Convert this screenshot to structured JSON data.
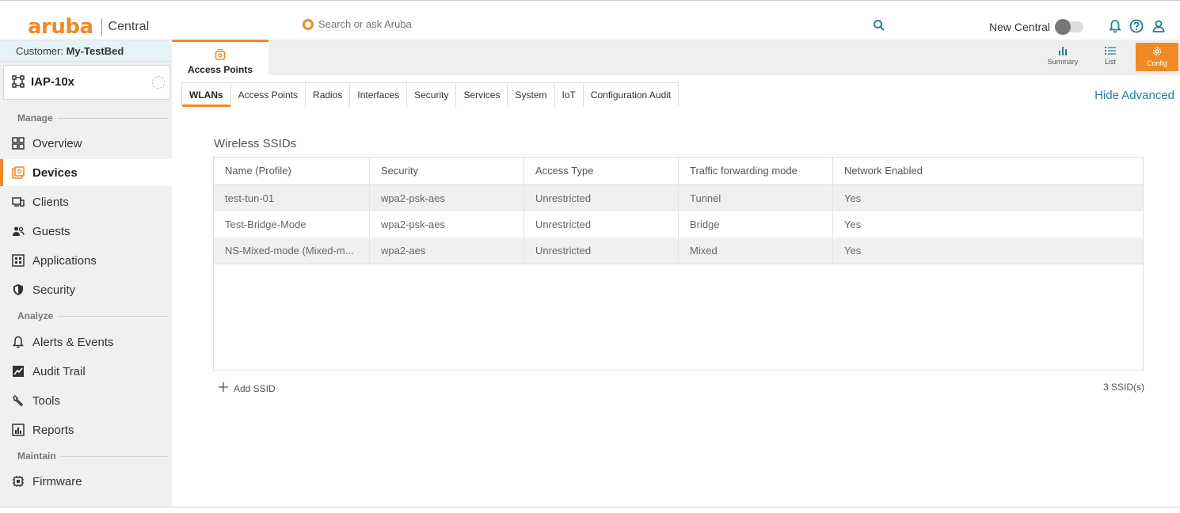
{
  "app": {
    "logo_text": "aruba",
    "product_name": "Central",
    "brand_color": "#f08a24",
    "link_color": "#1f7f93"
  },
  "topbar": {
    "search_placeholder": "Search or ask Aruba",
    "new_central_label": "New Central",
    "new_central_enabled": false,
    "icons": [
      "search-icon",
      "bell-icon",
      "help-icon",
      "user-icon"
    ]
  },
  "sidebar": {
    "customer_prefix": "Customer:",
    "customer_name": "My-TestBed",
    "group_name": "IAP-10x",
    "sections": {
      "manage": "Manage",
      "analyze": "Analyze",
      "maintain": "Maintain"
    },
    "items": [
      {
        "label": "Overview",
        "icon": "grid-icon"
      },
      {
        "label": "Devices",
        "icon": "devices-icon",
        "active": true
      },
      {
        "label": "Clients",
        "icon": "clients-icon"
      },
      {
        "label": "Guests",
        "icon": "guests-icon"
      },
      {
        "label": "Applications",
        "icon": "applications-icon"
      },
      {
        "label": "Security",
        "icon": "shield-icon"
      },
      {
        "label": "Alerts & Events",
        "icon": "bell-icon"
      },
      {
        "label": "Audit Trail",
        "icon": "audit-icon"
      },
      {
        "label": "Tools",
        "icon": "wrench-icon"
      },
      {
        "label": "Reports",
        "icon": "reports-icon"
      },
      {
        "label": "Firmware",
        "icon": "firmware-icon"
      }
    ]
  },
  "header": {
    "device_tab_label": "Access Points",
    "views": {
      "summary": "Summary",
      "list": "List",
      "config": "Config"
    }
  },
  "tabs": [
    "WLANs",
    "Access Points",
    "Radios",
    "Interfaces",
    "Security",
    "Services",
    "System",
    "IoT",
    "Configuration Audit"
  ],
  "active_tab": "WLANs",
  "hide_advanced_label": "Hide Advanced",
  "main": {
    "section_title": "Wireless SSIDs",
    "columns": [
      "Name (Profile)",
      "Security",
      "Access Type",
      "Traffic forwarding mode",
      "Network Enabled"
    ],
    "rows": [
      [
        "test-tun-01",
        "wpa2-psk-aes",
        "Unrestricted",
        "Tunnel",
        "Yes"
      ],
      [
        "Test-Bridge-Mode",
        "wpa2-psk-aes",
        "Unrestricted",
        "Bridge",
        "Yes"
      ],
      [
        "NS-Mixed-mode (Mixed-m...",
        "wpa2-aes",
        "Unrestricted",
        "Mixed",
        "Yes"
      ]
    ],
    "add_label": "Add SSID",
    "count_label": "3 SSID(s)"
  }
}
